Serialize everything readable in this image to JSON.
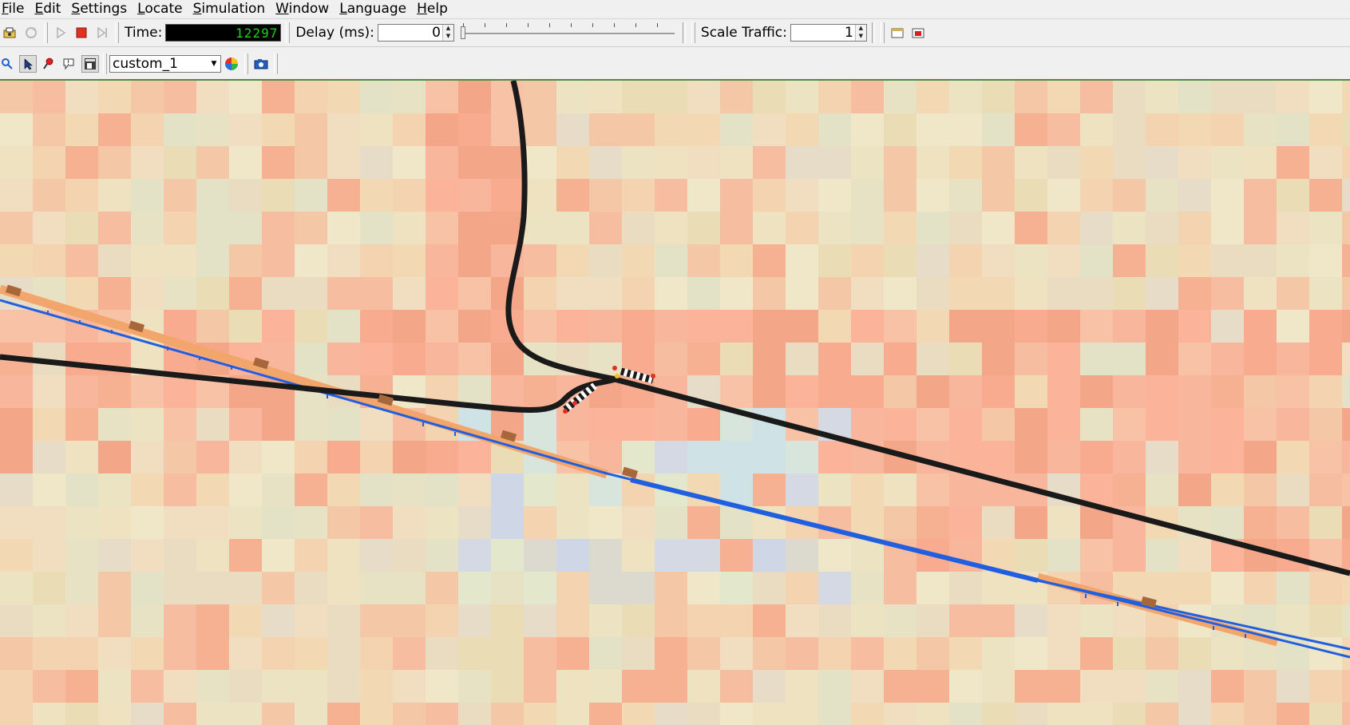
{
  "menu": {
    "items": [
      {
        "label": "File",
        "key": "F",
        "rest": "ile"
      },
      {
        "label": "Edit",
        "key": "E",
        "rest": "dit"
      },
      {
        "label": "Settings",
        "key": "S",
        "rest": "ettings"
      },
      {
        "label": "Locate",
        "key": "L",
        "rest": "ocate"
      },
      {
        "label": "Simulation",
        "key": "S",
        "rest": "imulation"
      },
      {
        "label": "Window",
        "key": "W",
        "rest": "indow"
      },
      {
        "label": "Language",
        "key": "L",
        "rest": "anguage"
      },
      {
        "label": "Help",
        "key": "H",
        "rest": "elp"
      }
    ]
  },
  "toolbar": {
    "time_label": "Time:",
    "time_value": "12297",
    "delay_label": "Delay (ms):",
    "delay_value": "0",
    "scale_label": "Scale Traffic:",
    "scale_value": "1",
    "icons": {
      "open": "open-simulation-icon",
      "reload": "reload-icon",
      "play": "play-icon",
      "stop": "stop-icon",
      "step": "step-icon",
      "new_view": "new-view-icon",
      "new_3d_view": "new-3d-view-icon"
    }
  },
  "view_toolbar": {
    "scheme_value": "custom_1",
    "icons": {
      "zoom": "zoom-icon",
      "select": "select-pointer-icon",
      "locate": "locate-icon",
      "tooltip": "tooltip-icon",
      "menu": "menu-icon",
      "color_wheel": "color-wheel-icon",
      "screenshot": "camera-icon"
    }
  },
  "colors": {
    "time_fg": "#19d419",
    "stop_red": "#e0301e",
    "road": "#1a1a1a",
    "rail": "#1f5fe0",
    "platform": "#f3a66b"
  }
}
